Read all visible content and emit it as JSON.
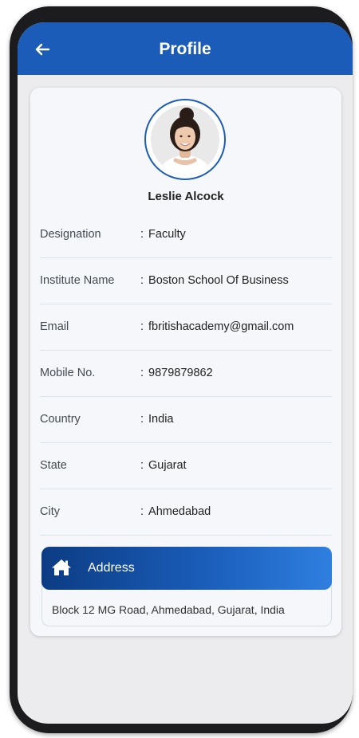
{
  "appbar": {
    "title": "Profile",
    "back_icon": "arrow-left-icon"
  },
  "profile": {
    "name": "Leslie Alcock",
    "avatar_icon": "user-photo"
  },
  "details": [
    {
      "label": "Designation",
      "value": "Faculty"
    },
    {
      "label": "Institute Name",
      "value": "Boston School Of Business"
    },
    {
      "label": "Email",
      "value": "fbritishacademy@gmail.com"
    },
    {
      "label": "Mobile No.",
      "value": "9879879862"
    },
    {
      "label": "Country",
      "value": "India"
    },
    {
      "label": "State",
      "value": "Gujarat"
    },
    {
      "label": "City",
      "value": "Ahmedabad"
    }
  ],
  "separator": ":",
  "address": {
    "title": "Address",
    "icon": "home-icon",
    "text": "Block 12  MG Road, Ahmedabad, Gujarat, India"
  },
  "colors": {
    "primary": "#1a5cb8",
    "primary_dark": "#0c3c83",
    "background": "#ececee",
    "card": "#f5f7fa"
  }
}
